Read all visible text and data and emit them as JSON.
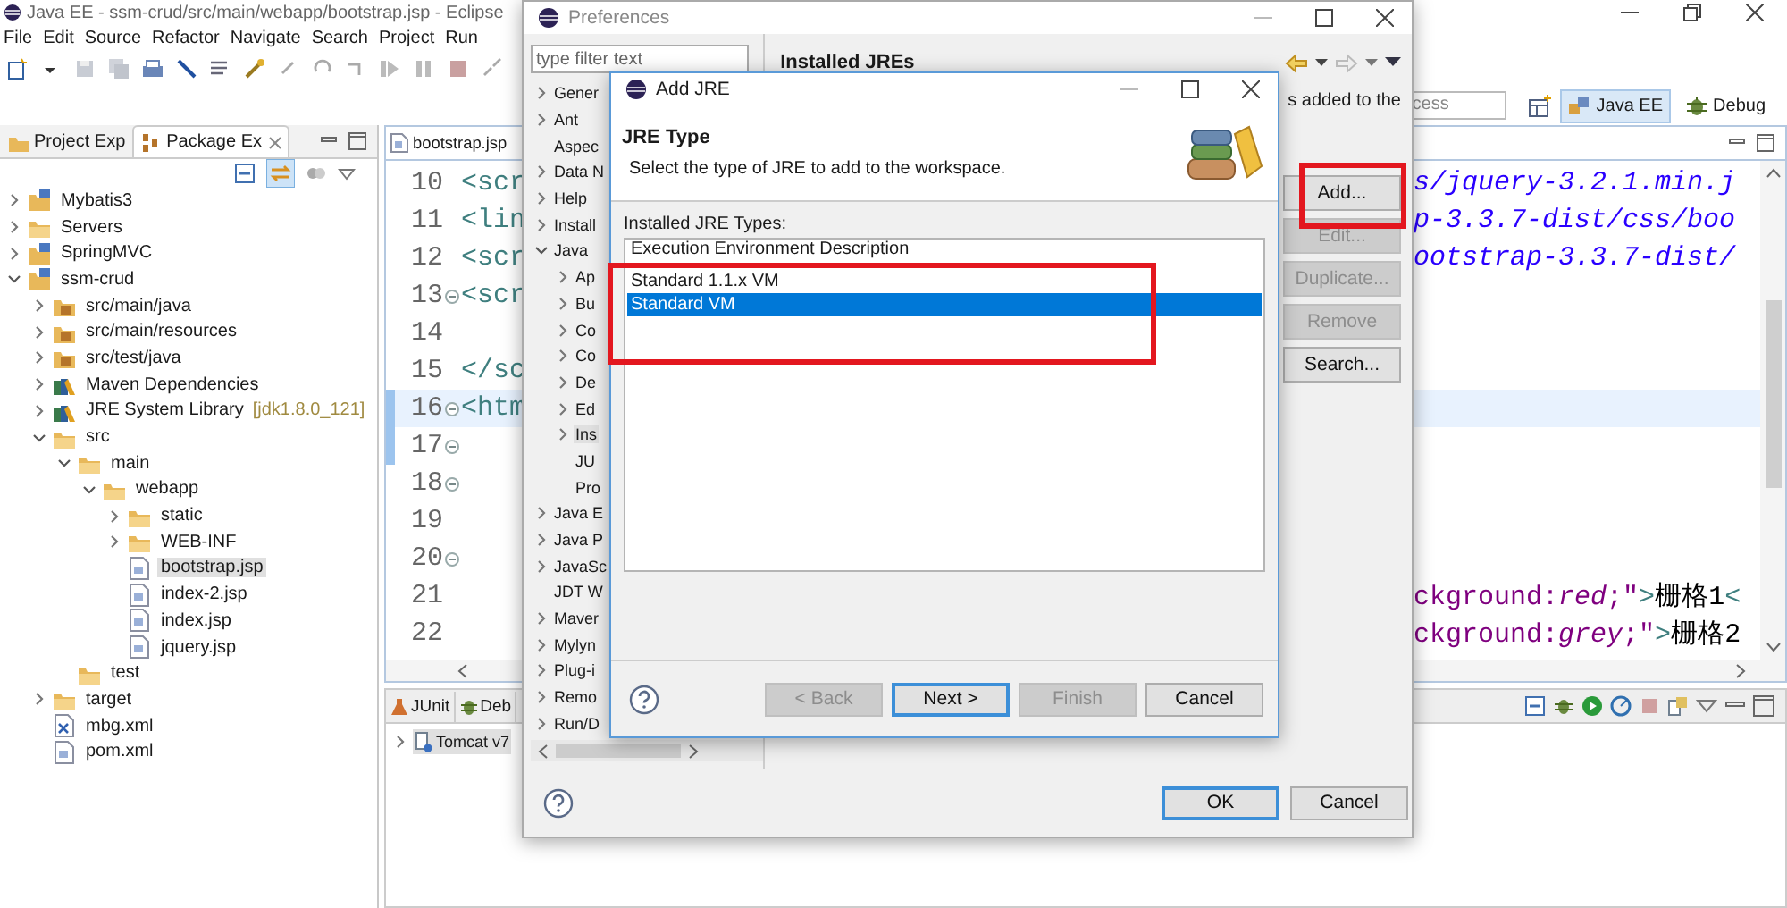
{
  "window": {
    "title": "Java EE - ssm-crud/src/main/webapp/bootstrap.jsp - Eclipse"
  },
  "menu": [
    "File",
    "Edit",
    "Source",
    "Refactor",
    "Navigate",
    "Search",
    "Project",
    "Run"
  ],
  "quick_access": {
    "placeholder": "cess"
  },
  "perspectives": [
    {
      "label": "Java EE",
      "selected": true
    },
    {
      "label": "Debug",
      "selected": false
    }
  ],
  "explorer": {
    "tabs": [
      {
        "label": "Project Exp",
        "selected": false
      },
      {
        "label": "Package Ex",
        "selected": true
      }
    ],
    "tree": [
      {
        "label": "Mybatis3",
        "kind": "project",
        "expanded": false,
        "selected": false
      },
      {
        "label": "Servers",
        "kind": "folder",
        "expanded": false,
        "selected": false
      },
      {
        "label": "SpringMVC",
        "kind": "project",
        "expanded": false,
        "selected": false
      },
      {
        "label": "ssm-crud",
        "kind": "project",
        "expanded": true,
        "selected": false,
        "children": [
          {
            "label": "src/main/java",
            "kind": "source",
            "expanded": false,
            "selected": false
          },
          {
            "label": "src/main/resources",
            "kind": "source",
            "expanded": false,
            "selected": false
          },
          {
            "label": "src/test/java",
            "kind": "source",
            "expanded": false,
            "selected": false
          },
          {
            "label": "Maven Dependencies",
            "kind": "library",
            "expanded": false,
            "selected": false
          },
          {
            "label": "JRE System Library",
            "decoration": "[jdk1.8.0_121]",
            "kind": "library",
            "expanded": false,
            "selected": false
          },
          {
            "label": "src",
            "kind": "folder",
            "expanded": true,
            "selected": false,
            "children": [
              {
                "label": "main",
                "kind": "folder",
                "expanded": true,
                "selected": false,
                "children": [
                  {
                    "label": "webapp",
                    "kind": "folder",
                    "expanded": true,
                    "selected": false,
                    "children": [
                      {
                        "label": "static",
                        "kind": "folder",
                        "expanded": false,
                        "selected": false
                      },
                      {
                        "label": "WEB-INF",
                        "kind": "folder",
                        "expanded": false,
                        "selected": false
                      },
                      {
                        "label": "bootstrap.jsp",
                        "kind": "file",
                        "selected": true
                      },
                      {
                        "label": "index-2.jsp",
                        "kind": "file",
                        "selected": false
                      },
                      {
                        "label": "index.jsp",
                        "kind": "file",
                        "selected": false
                      },
                      {
                        "label": "jquery.jsp",
                        "kind": "file",
                        "selected": false
                      }
                    ]
                  }
                ]
              },
              {
                "label": "test",
                "kind": "folder",
                "selected": false
              }
            ]
          },
          {
            "label": "target",
            "kind": "folder",
            "expanded": false,
            "selected": false
          },
          {
            "label": "mbg.xml",
            "kind": "xml",
            "selected": false
          },
          {
            "label": "pom.xml",
            "kind": "file",
            "selected": false
          }
        ]
      }
    ]
  },
  "editor": {
    "tab": "bootstrap.jsp",
    "lines": [
      {
        "number": "10",
        "fold": false,
        "current": false,
        "marked": false,
        "left": [
          {
            "kind": "tag",
            "text": "<scr"
          }
        ],
        "right": [
          {
            "kind": "string",
            "text": "s/jquery-3.2.1.min.j"
          }
        ]
      },
      {
        "number": "11",
        "fold": false,
        "current": false,
        "marked": false,
        "left": [
          {
            "kind": "tag",
            "text": "<lin"
          }
        ],
        "right": [
          {
            "kind": "string",
            "text": "p-3.3.7-dist/css/boo"
          }
        ]
      },
      {
        "number": "12",
        "fold": false,
        "current": false,
        "marked": false,
        "left": [
          {
            "kind": "tag",
            "text": "<scr"
          }
        ],
        "right": [
          {
            "kind": "string",
            "text": "ootstrap-3.3.7-dist/"
          }
        ]
      },
      {
        "number": "13",
        "fold": true,
        "current": false,
        "marked": false,
        "left": [
          {
            "kind": "tag",
            "text": "<scr"
          }
        ]
      },
      {
        "number": "14",
        "fold": false,
        "current": false,
        "marked": false
      },
      {
        "number": "15",
        "fold": false,
        "current": false,
        "marked": false,
        "left": [
          {
            "kind": "tag",
            "text": "</sc"
          }
        ]
      },
      {
        "number": "16",
        "fold": true,
        "current": true,
        "marked": true,
        "left": [
          {
            "kind": "tag",
            "text": "<htm"
          }
        ]
      },
      {
        "number": "17",
        "fold": true,
        "current": false,
        "marked": true
      },
      {
        "number": "18",
        "fold": true,
        "current": false,
        "marked": false
      },
      {
        "number": "19",
        "fold": false,
        "current": false,
        "marked": false
      },
      {
        "number": "20",
        "fold": true,
        "current": false,
        "marked": false
      },
      {
        "number": "21",
        "fold": false,
        "current": false,
        "marked": false,
        "right": [
          {
            "kind": "attr",
            "text": "ckground:"
          },
          {
            "kind": "value",
            "text": "red"
          },
          {
            "kind": "attr",
            "text": ";\""
          },
          {
            "kind": "tag",
            "text": ">"
          },
          {
            "kind": "text",
            "text": "栅格1"
          },
          {
            "kind": "tag",
            "text": "<"
          }
        ]
      },
      {
        "number": "22",
        "fold": false,
        "current": false,
        "marked": false,
        "right": [
          {
            "kind": "attr",
            "text": "ckground:"
          },
          {
            "kind": "value",
            "text": "grey"
          },
          {
            "kind": "attr",
            "text": ";\""
          },
          {
            "kind": "tag",
            "text": ">"
          },
          {
            "kind": "text",
            "text": "栅格2"
          }
        ]
      }
    ]
  },
  "bottom_panel": {
    "tabs": [
      {
        "label": "JUnit",
        "kind": "junit",
        "selected": false
      },
      {
        "label": "Deb",
        "kind": "debug",
        "selected": false
      }
    ],
    "rows": [
      {
        "label": "Tomcat v7",
        "selected": true
      }
    ]
  },
  "preferences": {
    "title": "Preferences",
    "filter": {
      "placeholder": "type filter text"
    },
    "tree": [
      {
        "label": "Gener",
        "expanded": false,
        "selected": false
      },
      {
        "label": "Ant",
        "expanded": false,
        "selected": false
      },
      {
        "label": "Aspec",
        "selected": false
      },
      {
        "label": "Data N",
        "expanded": false,
        "selected": false
      },
      {
        "label": "Help",
        "expanded": false,
        "selected": false
      },
      {
        "label": "Install",
        "expanded": false,
        "selected": false
      },
      {
        "label": "Java",
        "expanded": true,
        "selected": false,
        "children": [
          {
            "label": "Ap",
            "expanded": false,
            "selected": false
          },
          {
            "label": "Bu",
            "expanded": false,
            "selected": false
          },
          {
            "label": "Co",
            "expanded": false,
            "selected": false
          },
          {
            "label": "Co",
            "expanded": false,
            "selected": false
          },
          {
            "label": "De",
            "expanded": false,
            "selected": false
          },
          {
            "label": "Ed",
            "expanded": false,
            "selected": false
          },
          {
            "label": "Ins",
            "expanded": false,
            "selected": true
          },
          {
            "label": "JU",
            "selected": false
          },
          {
            "label": "Pro",
            "selected": false
          }
        ]
      },
      {
        "label": "Java E",
        "expanded": false,
        "selected": false
      },
      {
        "label": "Java P",
        "expanded": false,
        "selected": false
      },
      {
        "label": "JavaSc",
        "expanded": false,
        "selected": false
      },
      {
        "label": "JDT W",
        "selected": false
      },
      {
        "label": "Maver",
        "expanded": false,
        "selected": false
      },
      {
        "label": "Mylyn",
        "expanded": false,
        "selected": false
      },
      {
        "label": "Plug-i",
        "expanded": false,
        "selected": false
      },
      {
        "label": "Remo",
        "expanded": false,
        "selected": false
      },
      {
        "label": "Run/D",
        "expanded": false,
        "selected": false
      }
    ],
    "page_title": "Installed JREs",
    "description": "s added to the",
    "side_buttons": [
      {
        "label": "Add...",
        "disabled": false
      },
      {
        "label": "Edit...",
        "disabled": true
      },
      {
        "label": "Duplicate...",
        "disabled": true
      },
      {
        "label": "Remove",
        "disabled": true
      },
      {
        "label": "Search...",
        "disabled": false
      }
    ],
    "footer_buttons": [
      {
        "label": "OK",
        "default": true,
        "disabled": false
      },
      {
        "label": "Cancel",
        "default": false,
        "disabled": false
      }
    ]
  },
  "add_jre": {
    "title": "Add JRE",
    "heading": "JRE Type",
    "description": "Select the type of JRE to add to the workspace.",
    "list_label": "Installed JRE Types:",
    "list_header": "Execution Environment Description",
    "types": [
      {
        "label": "Standard 1.1.x VM",
        "selected": false
      },
      {
        "label": "Standard VM",
        "selected": true
      }
    ],
    "buttons": [
      {
        "label": "< Back",
        "default": false,
        "disabled": true
      },
      {
        "label": "Next >",
        "default": true,
        "disabled": false
      },
      {
        "label": "Finish",
        "default": false,
        "disabled": true
      },
      {
        "label": "Cancel",
        "default": false,
        "disabled": false
      }
    ]
  }
}
